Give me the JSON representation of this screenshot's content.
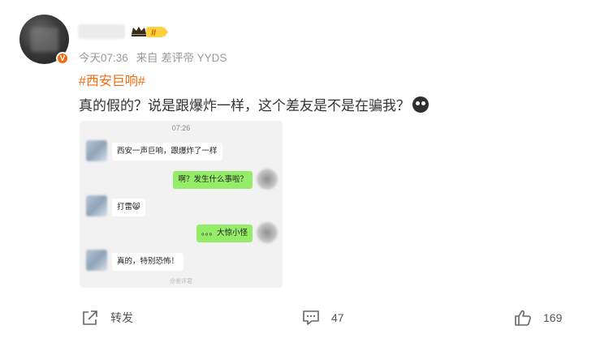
{
  "post": {
    "author_badge": "V",
    "level_label": "II",
    "timestamp": "今天07:36",
    "source": "来自 差评帝 YYDS",
    "hashtag": "#西安巨响#",
    "text": "真的假的？说是跟爆炸一样，这个差友是不是在骗我？"
  },
  "chat": {
    "time": "07:26",
    "messages": [
      {
        "side": "left",
        "text": "西安一声巨响，跟爆炸了一样"
      },
      {
        "side": "right",
        "text": "啊？发生什么事啦？"
      },
      {
        "side": "left",
        "text": "打雷😸"
      },
      {
        "side": "right",
        "text": "。。。大惊小怪"
      },
      {
        "side": "left",
        "text": "真的，特别恐怖！"
      }
    ],
    "watermark": "@差评君"
  },
  "actions": {
    "repost_label": "转发",
    "comment_count": "47",
    "like_count": "169"
  },
  "colors": {
    "accent": "#f26b0f",
    "bubble_right": "#95ec69"
  }
}
